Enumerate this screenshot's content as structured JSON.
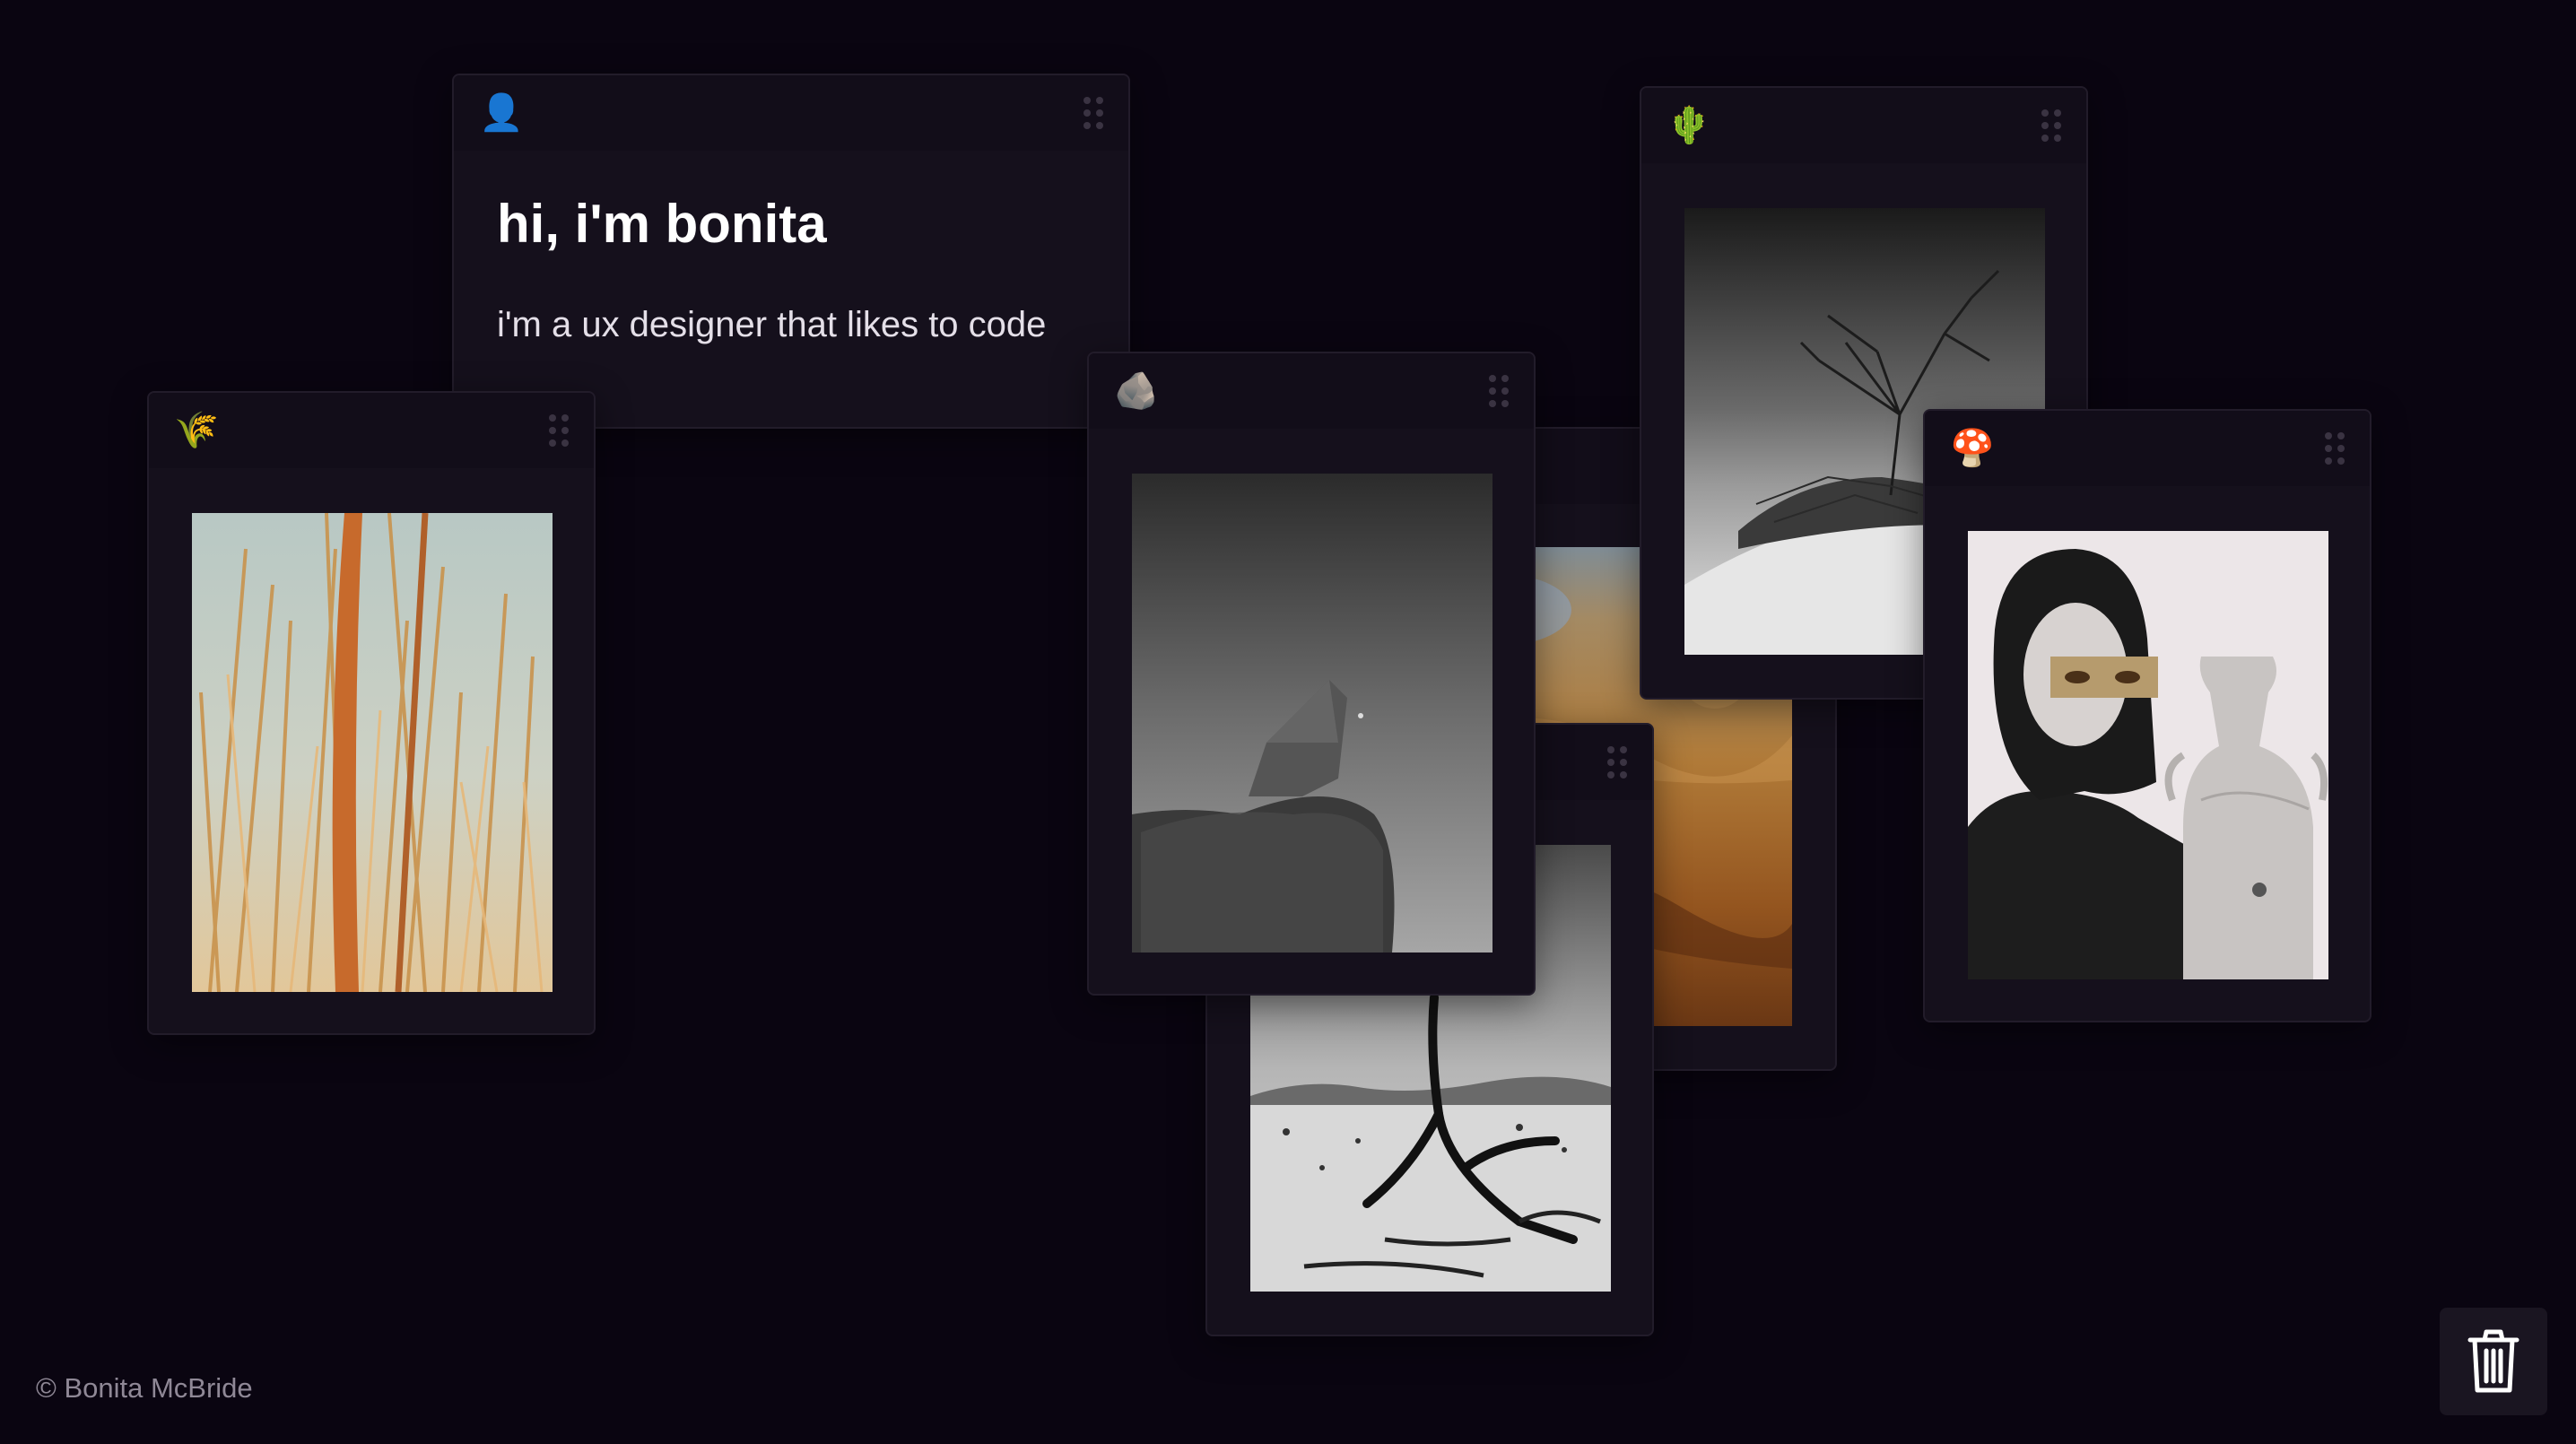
{
  "intro": {
    "icon": "bust-in-silhouette-icon",
    "icon_glyph": "👤",
    "title": "hi, i'm bonita",
    "text": "i'm a ux designer that likes to code"
  },
  "cards": [
    {
      "id": "grass",
      "icon": "rice-ear-icon",
      "glyph": "🌾",
      "photo": "golden dry grass reeds"
    },
    {
      "id": "rock",
      "icon": "rock-icon",
      "glyph": "🪨",
      "photo": "balanced rock against grey sky"
    },
    {
      "id": "cactus",
      "icon": "cactus-icon",
      "glyph": "🌵",
      "photo": "bare tree in snowy desert"
    },
    {
      "id": "mushroom",
      "icon": "mushroom-icon",
      "glyph": "🍄",
      "photo": "woman beside ceramic vase"
    },
    {
      "id": "driftwood",
      "icon": "hidden-icon",
      "glyph": "",
      "photo": "driftwood on desert sand"
    },
    {
      "id": "terrain",
      "icon": "hidden-icon",
      "glyph": "",
      "photo": "orange terrain with blue water"
    }
  ],
  "footer": {
    "copyright": "© Bonita McBride"
  },
  "trash": {
    "icon": "trash-icon",
    "label": "delete"
  },
  "colors": {
    "background": "#0a0511",
    "card": "#15101c",
    "card_header": "#120d19",
    "handle_dot": "#3a3342",
    "footer_text": "#8f8896"
  }
}
